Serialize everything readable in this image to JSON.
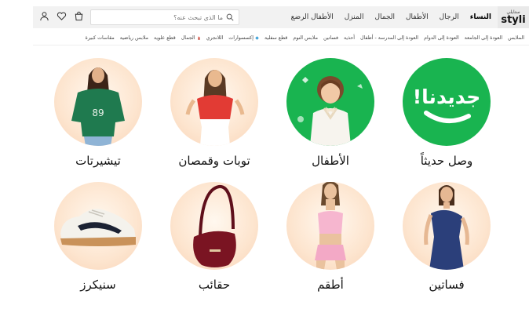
{
  "header": {
    "logo_ar": "ستايلي",
    "logo_en": "styli",
    "gender_tabs": [
      "النساء",
      "الرجال",
      "الأطفال",
      "الجمال",
      "المنزل",
      "الأطفال الرضع"
    ],
    "search_placeholder": "ما الذي تبحث عنه؟",
    "icons": [
      "user-icon",
      "heart-icon",
      "bag-icon"
    ]
  },
  "categories": [
    "الملابس",
    "العودة إلى الجامعة",
    "العودة إلى الدوام",
    "العودة إلى المدرسة - أطفال",
    "أحذية",
    "فساتين",
    "ملابس النوم",
    "قطع سفلية",
    "إكسسوارات",
    "اللانجري",
    "الجمال",
    "قطع علوية",
    "ملابس رياضية",
    "مقاسات كبيرة"
  ],
  "tiles": [
    {
      "label": "وصل حديثاً",
      "badge": "جديدنا!"
    },
    {
      "label": "الأطفال"
    },
    {
      "label": "توبات وقمصان"
    },
    {
      "label": "تيشيرتات"
    },
    {
      "label": "فساتين"
    },
    {
      "label": "أطقم"
    },
    {
      "label": "حقائب"
    },
    {
      "label": "سنيكرز"
    }
  ],
  "colors": {
    "accent_green": "#19b450",
    "bag_red": "#7a1422",
    "peach": "#fde5cf"
  }
}
